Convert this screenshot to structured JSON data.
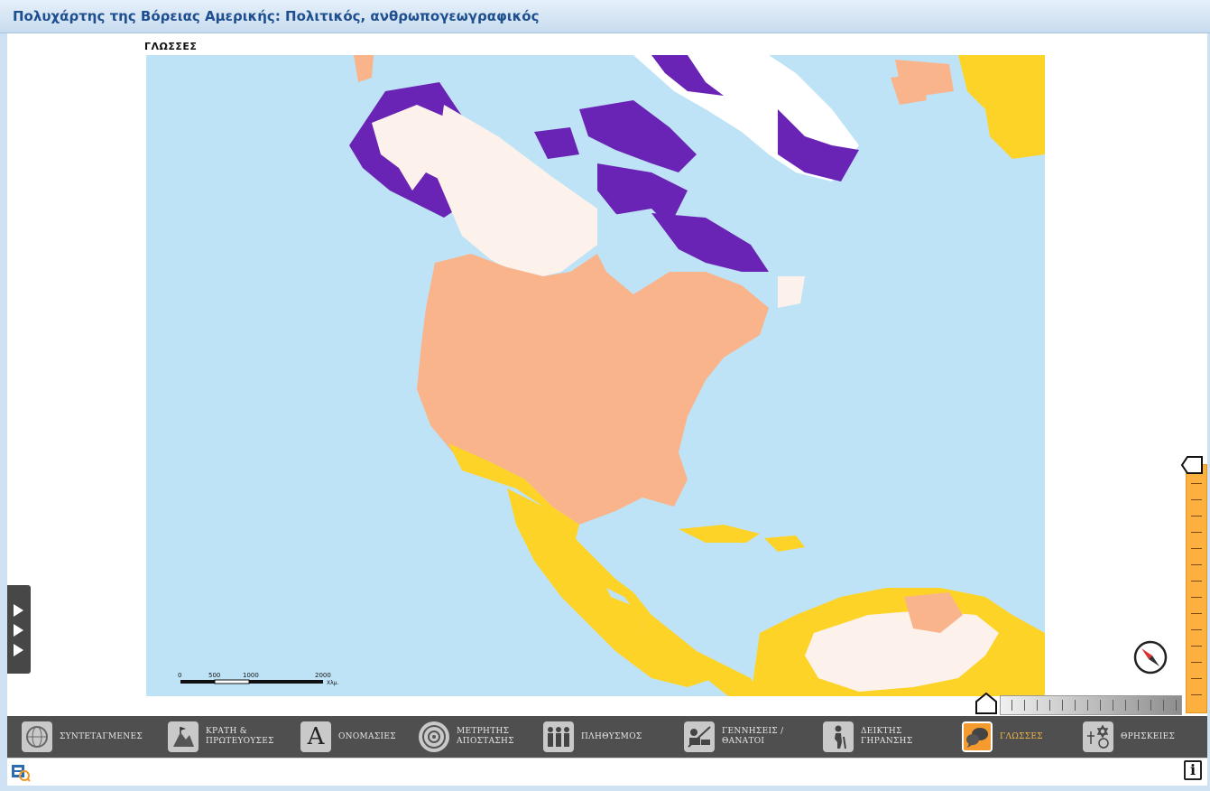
{
  "window": {
    "title": "Πολυχάρτης της Βόρειας Αμερικής: Πολιτικός, ανθρωπογεωγραφικός"
  },
  "map": {
    "layer_label": "ΓΛΩΣΣΕΣ",
    "colors": {
      "ocean": "#bfe3f6",
      "english": "#f9b48c",
      "spanish": "#fdd327",
      "inuit": "#6a24b5",
      "french": "#fdf2eb",
      "portuguese": "#fdf2eb",
      "other": "#ffffff"
    },
    "scale": {
      "ticks": [
        "0",
        "500",
        "1000",
        "2000"
      ],
      "unit": "Χλμ."
    }
  },
  "side_panel": {
    "icon": "play-arrows-icon"
  },
  "compass": {
    "icon": "compass-icon"
  },
  "zoom": {
    "vertical_icon": "zoom-slider",
    "horizontal_icon": "zoom-slider"
  },
  "toolbar": {
    "items": [
      {
        "label": "ΣΥΝΤΕΤΑΓΜΕΝΕΣ",
        "icon": "globe-grid-icon"
      },
      {
        "label": "ΚΡΑΤΗ &\nΠΡΩΤΕΥΟΥΣΕΣ",
        "icon": "mountain-flag-icon"
      },
      {
        "label": "ΟΝΟΜΑΣΙΕΣ",
        "icon": "letter-a-icon"
      },
      {
        "label": "ΜΕΤΡΗΤΗΣ\nΑΠΟΣΤΑΣΗΣ",
        "icon": "target-icon"
      },
      {
        "label": "ΠΛΗΘΥΣΜΟΣ",
        "icon": "people-icon"
      },
      {
        "label": "ΓΕΝΝΗΣΕΙΣ /\nΘΑΝΑΤΟΙ",
        "icon": "birth-death-icon"
      },
      {
        "label": "ΔΕΙΚΤΗΣ\nΓΗΡΑΝΣΗΣ",
        "icon": "elderly-person-icon"
      },
      {
        "label": "ΓΛΩΣΣΕΣ",
        "icon": "speech-bubbles-icon",
        "active": true
      },
      {
        "label": "ΘΡΗΣΚΕΙΕΣ",
        "icon": "religion-symbols-icon"
      }
    ]
  },
  "status": {
    "info_label": "i"
  }
}
